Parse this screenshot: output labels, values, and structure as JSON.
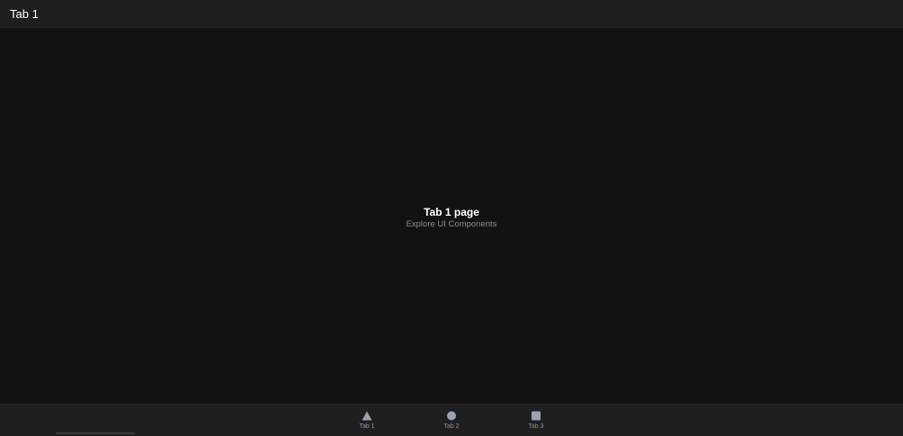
{
  "header": {
    "title": "Tab 1"
  },
  "main": {
    "title": "Tab 1 page",
    "subtitle": "Explore UI Components"
  },
  "tabbar": {
    "tabs": [
      {
        "label": "Tab 1",
        "icon": "triangle-icon",
        "active": true
      },
      {
        "label": "Tab 2",
        "icon": "circle-icon",
        "active": false
      },
      {
        "label": "Tab 3",
        "icon": "square-icon",
        "active": false
      }
    ]
  },
  "colors": {
    "background": "#121212",
    "toolbar": "#1f1f1f",
    "icon": "#9aa3b2",
    "muted_text": "#8f8f94"
  }
}
